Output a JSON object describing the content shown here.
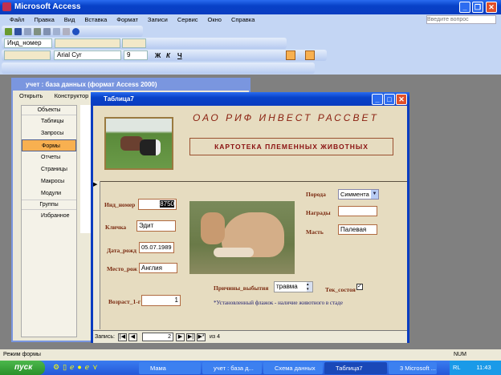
{
  "app": {
    "title": "Microsoft Access"
  },
  "menu": [
    "Файл",
    "Правка",
    "Вид",
    "Вставка",
    "Формат",
    "Записи",
    "Сервис",
    "Окно",
    "Справка"
  ],
  "help_box": {
    "placeholder": "Введите вопрос"
  },
  "toolbar": {
    "field_combo": "Инд_номер",
    "font": "Arial Cyr",
    "size": "9",
    "bold": "Ж",
    "italic": "К",
    "underline": "Ч"
  },
  "db_window": {
    "title": "учет : база данных (формат Access 2000)",
    "open": "Открыть",
    "design": "Конструктор",
    "objects_header": "Объекты",
    "objects": [
      "Таблицы",
      "Запросы",
      "Формы",
      "Отчеты",
      "Страницы",
      "Макросы",
      "Модули"
    ],
    "selected": "Формы",
    "groups_header": "Группы",
    "groups": [
      "Избранное"
    ]
  },
  "form_window": {
    "title": "Таблица7",
    "company": "ОАО РИФ ИНВЕСТ РАССВЕТ",
    "subtitle": "КАРТОТЕКА ПЛЕМЕННЫХ ЖИВОТНЫХ",
    "fields": {
      "id": {
        "label": "Инд_номер",
        "value": "8750"
      },
      "name": {
        "label": "Кличка",
        "value": "Эдит"
      },
      "birth": {
        "label": "Дата_рожд",
        "value": "05.07.1989"
      },
      "place": {
        "label": "Место_рож",
        "value": "Англия"
      },
      "age": {
        "label": "Возраст_1-г",
        "value": "1"
      },
      "breed": {
        "label": "Порода",
        "value": "Симмента"
      },
      "awards": {
        "label": "Награды",
        "value": ""
      },
      "color": {
        "label": "Масть",
        "value": "Палевая"
      },
      "reason": {
        "label": "Причины_выбытия",
        "value": "травма"
      },
      "state": {
        "label": "Тек_состоя",
        "checked": true
      }
    },
    "note": "*Установленный флажок - наличие животного в стаде",
    "nav": {
      "label": "Запись:",
      "current": "2",
      "of": "из",
      "total": "4"
    }
  },
  "status": {
    "mode": "Режим формы",
    "num": "NUM"
  },
  "taskbar": {
    "start": "пуск",
    "tasks": [
      "Мама",
      "учет : база д...",
      "Схема данных",
      "Таблица7",
      "3 Microsoft ..."
    ],
    "active": "Таблица7",
    "lang": "RL",
    "clock": "11:43"
  }
}
